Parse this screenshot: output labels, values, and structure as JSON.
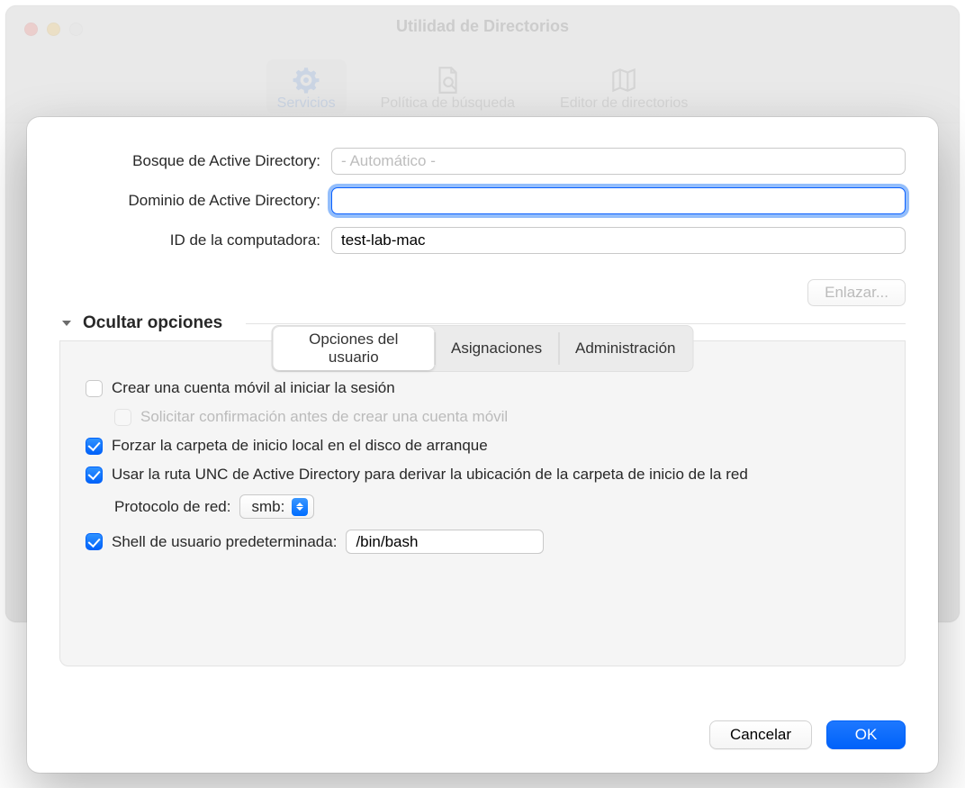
{
  "window": {
    "title": "Utilidad de Directorios",
    "toolbar": {
      "services": "Servicios",
      "search_policy": "Política de búsqueda",
      "directory_editor": "Editor de directorios"
    }
  },
  "form": {
    "forest_label": "Bosque de Active Directory:",
    "forest_placeholder": "- Automático -",
    "forest_value": "",
    "domain_label": "Dominio de Active Directory:",
    "domain_value": "",
    "computer_id_label": "ID de la computadora:",
    "computer_id_value": "test-lab-mac",
    "bind_button": "Enlazar..."
  },
  "disclosure": {
    "title": "Ocultar opciones"
  },
  "tabs": {
    "user_experience": "Opciones del usuario",
    "mappings": "Asignaciones",
    "administrative": "Administración"
  },
  "options": {
    "mobile_account": {
      "label": "Crear una cuenta móvil al iniciar la sesión",
      "checked": false
    },
    "confirm_create": {
      "label": "Solicitar confirmación antes de crear una cuenta móvil",
      "checked": false,
      "disabled": true
    },
    "force_local_home": {
      "label": "Forzar la carpeta de inicio local en el disco de arranque",
      "checked": true
    },
    "use_unc": {
      "label": "Usar la ruta UNC de Active Directory para derivar la ubicación de la carpeta de inicio de la red",
      "checked": true
    },
    "protocol_label": "Protocolo de red:",
    "protocol_value": "smb:",
    "default_shell": {
      "label": "Shell de usuario predeterminada:",
      "checked": true,
      "value": "/bin/bash"
    }
  },
  "footer": {
    "cancel": "Cancelar",
    "ok": "OK"
  }
}
